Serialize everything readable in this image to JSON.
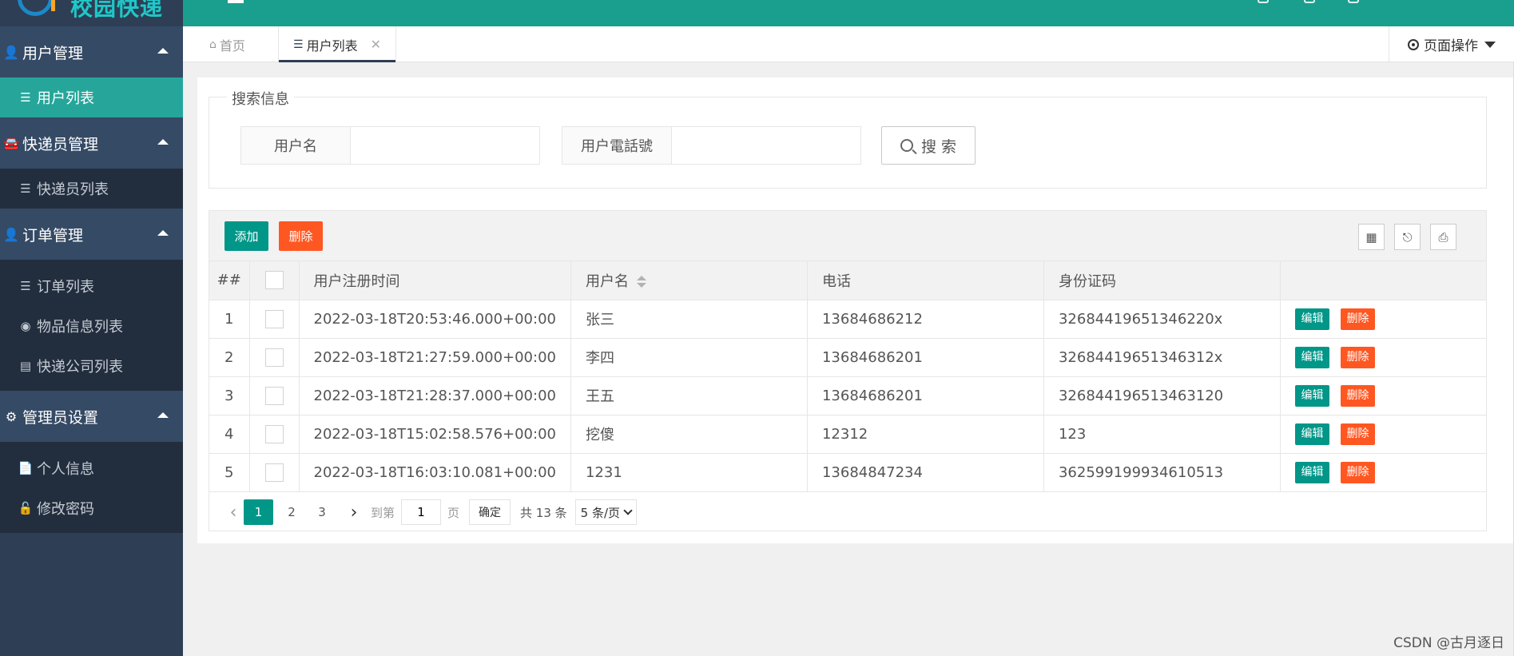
{
  "app": {
    "logo_text": "校园快递"
  },
  "sidebar": {
    "groups": [
      {
        "label": "用户管理",
        "icon": "user-icon",
        "items": [
          {
            "label": "用户列表",
            "icon": "list-icon",
            "active": true
          }
        ]
      },
      {
        "label": "快递员管理",
        "icon": "car-icon",
        "items": [
          {
            "label": "快递员列表",
            "icon": "list-icon"
          }
        ]
      },
      {
        "label": "订单管理",
        "icon": "user-icon",
        "items": [
          {
            "label": "订单列表",
            "icon": "list-icon"
          },
          {
            "label": "物品信息列表",
            "icon": "dashboard-icon"
          },
          {
            "label": "快递公司列表",
            "icon": "briefcase-icon"
          }
        ]
      },
      {
        "label": "管理员设置",
        "icon": "gears-icon",
        "items": [
          {
            "label": "个人信息",
            "icon": "file-icon"
          },
          {
            "label": "修改密码",
            "icon": "lock-icon"
          }
        ]
      }
    ]
  },
  "tabs": [
    {
      "label": "首页",
      "icon": "home-icon"
    },
    {
      "label": "用户列表",
      "icon": "list-icon",
      "active": true
    }
  ],
  "page_ops": {
    "label": "页面操作"
  },
  "search": {
    "legend": "搜索信息",
    "username_label": "用户名",
    "username_value": "",
    "phone_label": "用户電話號",
    "phone_value": "",
    "button_label": "搜 索"
  },
  "toolbar": {
    "add_label": "添加",
    "delete_label": "删除"
  },
  "table": {
    "headers": {
      "idx": "##",
      "time": "用户注册时间",
      "name": "用户名",
      "phone": "电话",
      "idcard": "身份证码"
    },
    "row_edit_label": "编辑",
    "row_delete_label": "删除",
    "rows": [
      {
        "idx": "1",
        "time": "2022-03-18T20:53:46.000+00:00",
        "name": "张三",
        "phone": "13684686212",
        "idcard": "32684419651346220x"
      },
      {
        "idx": "2",
        "time": "2022-03-18T21:27:59.000+00:00",
        "name": "李四",
        "phone": "13684686201",
        "idcard": "32684419651346312x"
      },
      {
        "idx": "3",
        "time": "2022-03-18T21:28:37.000+00:00",
        "name": "王五",
        "phone": "13684686201",
        "idcard": "326844196513463120"
      },
      {
        "idx": "4",
        "time": "2022-03-18T15:02:58.576+00:00",
        "name": "挖傻",
        "phone": "12312",
        "idcard": "123"
      },
      {
        "idx": "5",
        "time": "2022-03-18T16:03:10.081+00:00",
        "name": "1231",
        "phone": "13684847234",
        "idcard": "362599199934610513"
      }
    ]
  },
  "pagination": {
    "pages": [
      "1",
      "2",
      "3"
    ],
    "current": "1",
    "goto_prefix": "到第",
    "goto_value": "1",
    "goto_suffix": "页",
    "confirm_label": "确定",
    "total": "共 13 条",
    "page_size": "5 条/页"
  },
  "watermark": "CSDN @古月逐日",
  "colors": {
    "primary": "#009688",
    "danger": "#ff5722",
    "sidebar": "#2d3e55",
    "topbar": "#1a9e8e"
  }
}
